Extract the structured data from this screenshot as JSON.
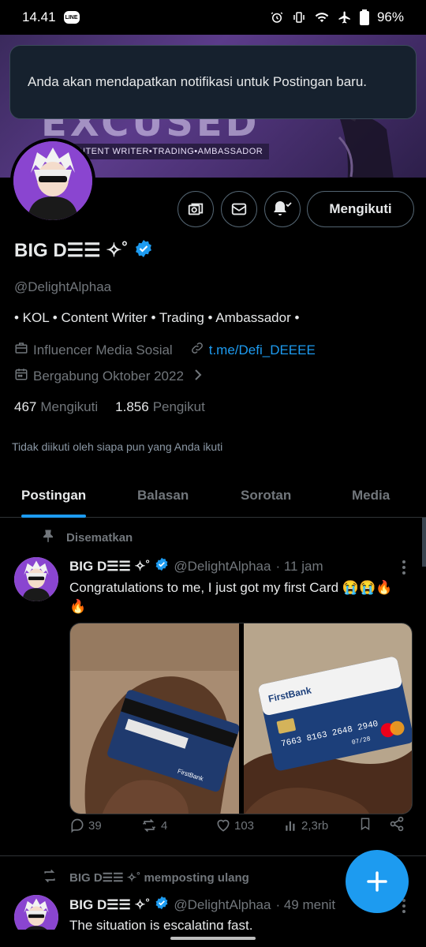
{
  "status_bar": {
    "time": "14.41",
    "line_badge": "LINE",
    "battery": "96%"
  },
  "toast": {
    "text": "Anda akan mendapatkan notifikasi untuk Postingan baru."
  },
  "banner": {
    "big_text": "EXCUSED",
    "tagline": "NTENT WRITER•TRADING•AMBASSADOR"
  },
  "profile": {
    "follow_button": "Mengikuti",
    "name": "BIG D☰☰ ✧˚",
    "handle": "@DelightAlphaa",
    "bio": "• KOL • Content Writer • Trading • Ambassador •",
    "category": "Influencer Media Sosial",
    "link": "t.me/Defi_DEEEE",
    "joined": "Bergabung Oktober 2022",
    "following_count": "467",
    "following_label": "Mengikuti",
    "followers_count": "1.856",
    "followers_label": "Pengikut",
    "followed_by": "Tidak diikuti oleh siapa pun yang Anda ikuti"
  },
  "tabs": [
    {
      "label": "Postingan",
      "active": true
    },
    {
      "label": "Balasan",
      "active": false
    },
    {
      "label": "Sorotan",
      "active": false
    },
    {
      "label": "Media",
      "active": false
    }
  ],
  "posts": [
    {
      "context": "Disematkan",
      "name": "BIG D☰☰ ✧˚",
      "handle": "@DelightAlphaa",
      "time": "· 11 jam",
      "text": "Congratulations to me, I just got my first Card 😭😭🔥🔥",
      "card_brand": "FirstBank",
      "card_number": "7663 8163 2648 2940",
      "card_expiry": "07/28",
      "replies": "39",
      "reposts": "4",
      "likes": "103",
      "views": "2,3rb"
    },
    {
      "context": "BIG D☰☰ ✧˚ memposting ulang",
      "name": "BIG D☰☰ ✧˚",
      "handle": "@DelightAlphaa",
      "time": "· 49 menit",
      "text": "The situation is escalating fast."
    }
  ],
  "colors": {
    "accent": "#1d9bf0",
    "background": "#000000",
    "muted": "#71767b",
    "border": "#2f3336"
  }
}
